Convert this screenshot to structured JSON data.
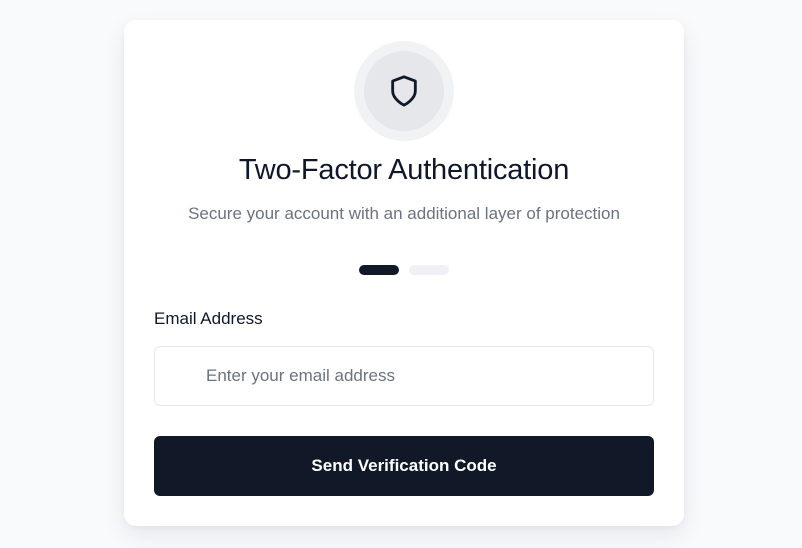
{
  "header": {
    "icon": "shield-icon",
    "title": "Two-Factor Authentication",
    "subtitle": "Secure your account with an additional layer of protection"
  },
  "steps": {
    "current": 1,
    "total": 2
  },
  "form": {
    "email_label": "Email Address",
    "email_placeholder": "Enter your email address",
    "email_value": "",
    "submit_label": "Send Verification Code"
  },
  "colors": {
    "primary": "#111827",
    "background": "#f8fafc",
    "muted_text": "#6b7280",
    "step_inactive": "#eef2f6"
  }
}
